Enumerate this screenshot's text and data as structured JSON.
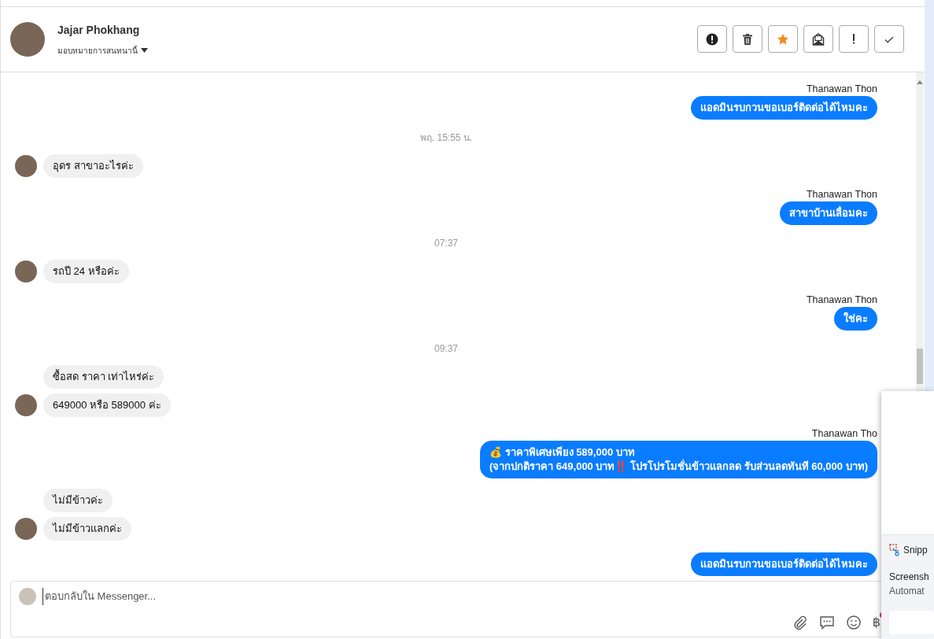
{
  "header": {
    "name": "Jajar Phokhang",
    "assign_label": "มอบหมายการสนทนานี้",
    "buttons": [
      {
        "kind": "alert"
      },
      {
        "kind": "trash"
      },
      {
        "kind": "star",
        "on": true
      },
      {
        "kind": "mail"
      },
      {
        "kind": "important"
      },
      {
        "kind": "done"
      }
    ]
  },
  "messages": [
    {
      "kind": "sender",
      "text": "Thanawan Thon"
    },
    {
      "kind": "outgoing",
      "text": "แอดมินรบกวนขอเบอร์ติดต่อได้ไหมคะ"
    },
    {
      "kind": "time",
      "text": "พฤ. 15:55 น."
    },
    {
      "kind": "incoming",
      "text": "อุดร สาขาอะไรค่ะ",
      "avatar": true
    },
    {
      "kind": "sender",
      "text": "Thanawan Thon"
    },
    {
      "kind": "outgoing",
      "text": "สาขาบ้านเลื่อมคะ"
    },
    {
      "kind": "time",
      "text": "07:37"
    },
    {
      "kind": "incoming",
      "text": "รถปี 24 หรือค่ะ",
      "avatar": true
    },
    {
      "kind": "sender",
      "text": "Thanawan Thon"
    },
    {
      "kind": "outgoing",
      "text": "ใช่คะ"
    },
    {
      "kind": "time",
      "text": "09:37"
    },
    {
      "kind": "incoming",
      "text": "ซื้อสด ราคา เท่าไหร่ค่ะ",
      "avatar": false
    },
    {
      "kind": "incoming",
      "text": "649000 หรือ 589000 ค่ะ",
      "avatar": true
    },
    {
      "kind": "sender",
      "text": "Thanawan Tho"
    },
    {
      "kind": "outgoing",
      "text": "💰 ราคาพิเศษเพียง 589,000 บาท\n(จากปกติราคา 649,000 บาท‼️ โปรโปรโมชั่นข้าวแลกลด รับส่วนลดทันที 60,000 บาท)"
    },
    {
      "kind": "incoming",
      "text": "ไม่มีข้าวค่ะ",
      "avatar": false
    },
    {
      "kind": "incoming",
      "text": "ไม่มีข้าวแลกค่ะ",
      "avatar": true
    },
    {
      "kind": "outgoing",
      "text": "แอดมินรบกวนขอเบอร์ติดต่อได้ไหมคะ"
    }
  ],
  "composer": {
    "placeholder": "ตอบกลับใน Messenger...",
    "baht_icon": "฿"
  },
  "notification": {
    "app": "Snipp",
    "title": "Screensh",
    "subtitle": "Automat"
  }
}
